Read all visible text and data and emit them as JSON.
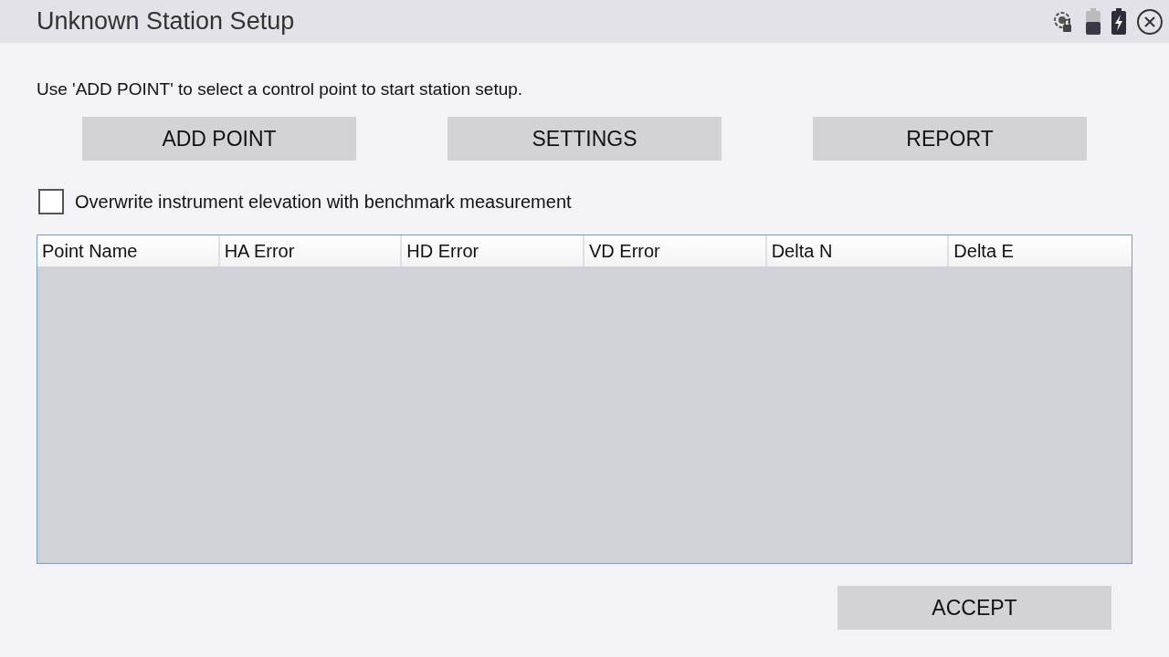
{
  "window": {
    "title": "Unknown Station Setup"
  },
  "instruction": "Use 'ADD POINT' to select a control point to start station setup.",
  "buttons": [
    "ADD POINT",
    "SETTINGS",
    "REPORT"
  ],
  "overwrite_option": {
    "label": "Overwrite instrument elevation with benchmark measurement",
    "checked": false
  },
  "table": {
    "columns": [
      "Point Name",
      "HA Error",
      "HD Error",
      "VD Error",
      "Delta N",
      "Delta E"
    ]
  },
  "accept_button": "ACCEPT"
}
